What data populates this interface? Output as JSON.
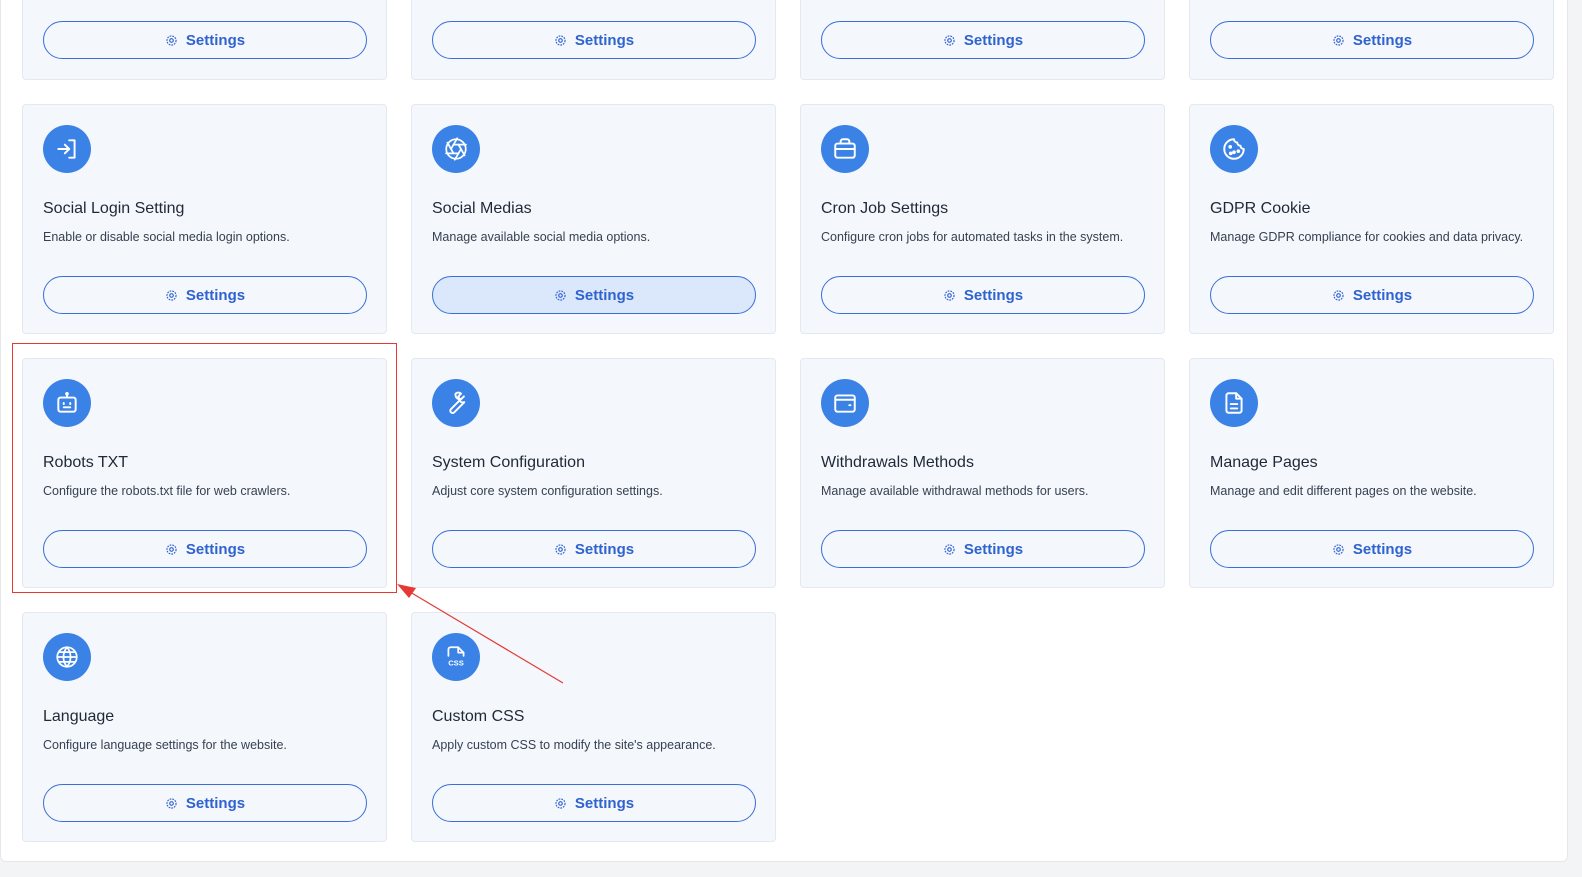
{
  "button_label": "Settings",
  "accent_color": "#3b82e6",
  "top_row_partial": [
    {
      "id": "top-1"
    },
    {
      "id": "top-2"
    },
    {
      "id": "top-3"
    },
    {
      "id": "top-4"
    }
  ],
  "cards": [
    {
      "title": "Social Login Setting",
      "description": "Enable or disable social media login options.",
      "icon": "login-icon"
    },
    {
      "title": "Social Medias",
      "description": "Manage available social media options.",
      "icon": "aperture-icon"
    },
    {
      "title": "Cron Job Settings",
      "description": "Configure cron jobs for automated tasks in the system.",
      "icon": "briefcase-icon"
    },
    {
      "title": "GDPR Cookie",
      "description": "Manage GDPR compliance for cookies and data privacy.",
      "icon": "cookie-icon"
    },
    {
      "title": "Robots TXT",
      "description": "Configure the robots.txt file for web crawlers.",
      "icon": "robot-icon"
    },
    {
      "title": "System Configuration",
      "description": "Adjust core system configuration settings.",
      "icon": "wrench-icon"
    },
    {
      "title": "Withdrawals Methods",
      "description": "Manage available withdrawal methods for users.",
      "icon": "wallet-icon"
    },
    {
      "title": "Manage Pages",
      "description": "Manage and edit different pages on the website.",
      "icon": "file-text-icon"
    },
    {
      "title": "Language",
      "description": "Configure language settings for the website.",
      "icon": "globe-icon"
    },
    {
      "title": "Custom CSS",
      "description": "Apply custom CSS to modify the site's appearance.",
      "icon": "css-file-icon"
    }
  ],
  "annotation": {
    "highlight_color": "#e53935",
    "target_card": "Robots TXT"
  }
}
